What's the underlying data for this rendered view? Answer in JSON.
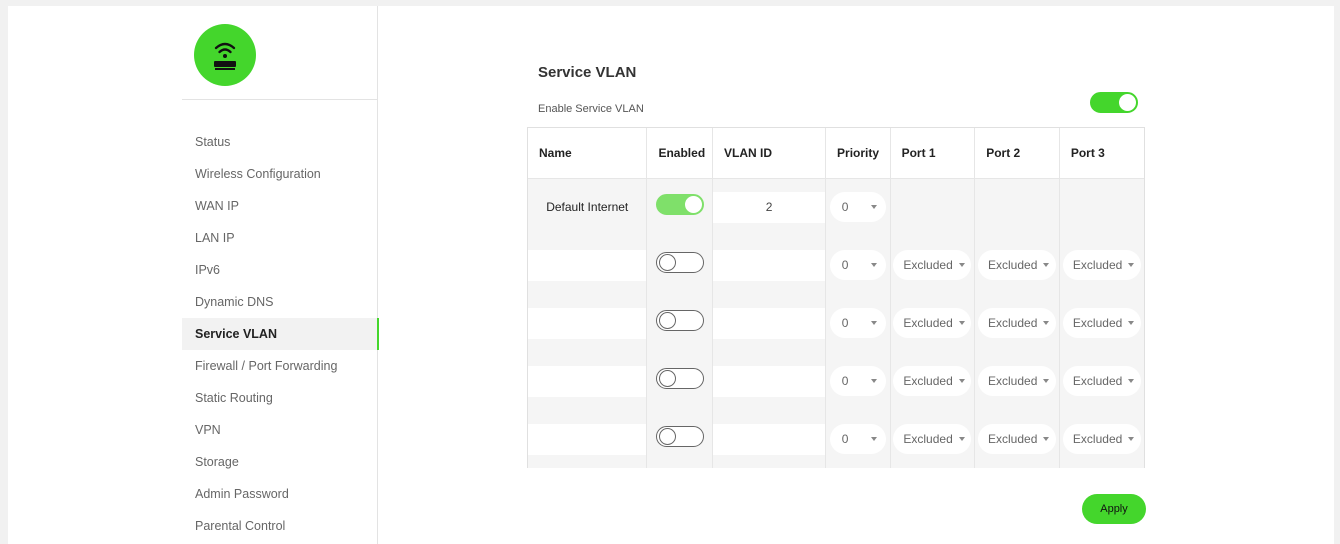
{
  "brand": {
    "accent": "#44d62c",
    "logo_icon": "wifi-router-icon"
  },
  "sidebar": {
    "items": [
      {
        "label": "Status"
      },
      {
        "label": "Wireless Configuration"
      },
      {
        "label": "WAN IP"
      },
      {
        "label": "LAN IP"
      },
      {
        "label": "IPv6"
      },
      {
        "label": "Dynamic DNS"
      },
      {
        "label": "Service VLAN",
        "active": true
      },
      {
        "label": "Firewall / Port Forwarding"
      },
      {
        "label": "Static Routing"
      },
      {
        "label": "VPN"
      },
      {
        "label": "Storage"
      },
      {
        "label": "Admin Password"
      },
      {
        "label": "Parental Control"
      }
    ]
  },
  "main": {
    "title": "Service VLAN",
    "enable_label": "Enable Service VLAN",
    "enable_on": true,
    "table": {
      "headers": [
        "Name",
        "Enabled",
        "VLAN ID",
        "Priority",
        "Port 1",
        "Port 2",
        "Port 3"
      ],
      "default_row": {
        "name": "Default Internet",
        "enabled": true,
        "vlan_id": "2",
        "priority": "0"
      },
      "rows": [
        {
          "name": "",
          "enabled": false,
          "vlan_id": "",
          "priority": "0",
          "port1": "Excluded",
          "port2": "Excluded",
          "port3": "Excluded"
        },
        {
          "name": "",
          "enabled": false,
          "vlan_id": "",
          "priority": "0",
          "port1": "Excluded",
          "port2": "Excluded",
          "port3": "Excluded"
        },
        {
          "name": "",
          "enabled": false,
          "vlan_id": "",
          "priority": "0",
          "port1": "Excluded",
          "port2": "Excluded",
          "port3": "Excluded"
        },
        {
          "name": "",
          "enabled": false,
          "vlan_id": "",
          "priority": "0",
          "port1": "Excluded",
          "port2": "Excluded",
          "port3": "Excluded"
        }
      ]
    },
    "apply_label": "Apply"
  }
}
